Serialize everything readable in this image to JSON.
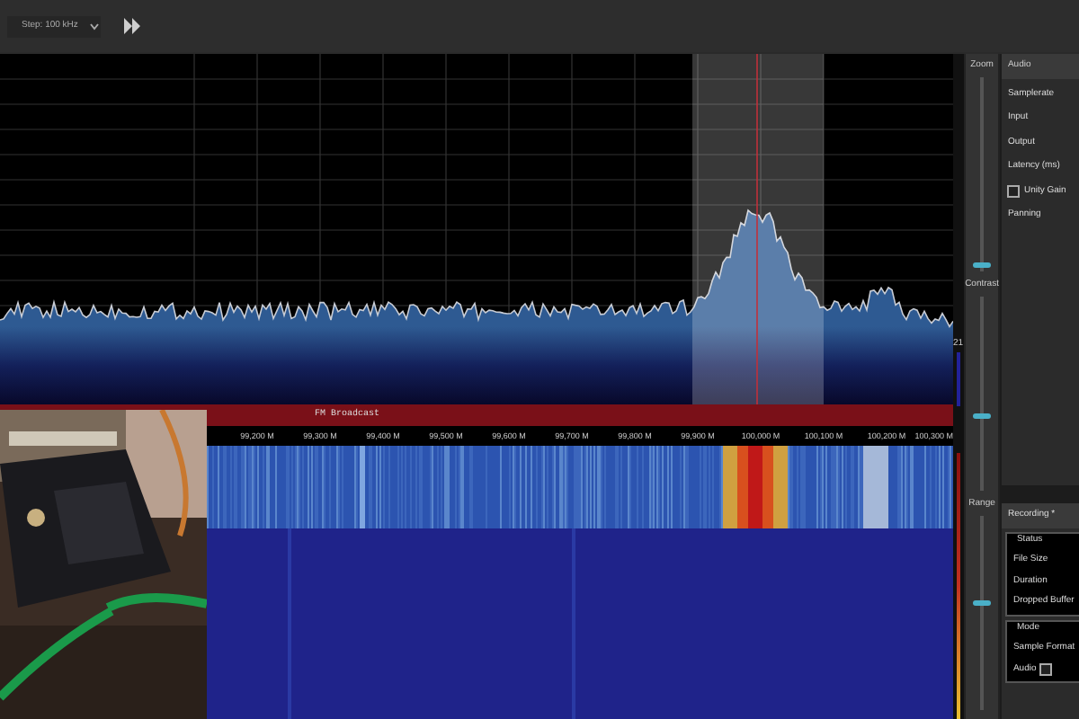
{
  "toolbar": {
    "step": "Step: 100 kHz"
  },
  "band": {
    "label": "FM Broadcast"
  },
  "frequency_axis": [
    "99,200 M",
    "99,300 M",
    "99,400 M",
    "99,500 M",
    "99,600 M",
    "99,700 M",
    "99,800 M",
    "99,900 M",
    "100,000 M",
    "100,100 M",
    "100,200 M",
    "100,300 M"
  ],
  "level_meter": {
    "reading": "21"
  },
  "sliders": [
    {
      "label": "Zoom",
      "level": 0.03
    },
    {
      "label": "Contrast",
      "level": 0.38
    },
    {
      "label": "Range",
      "level": 0.55
    }
  ],
  "audio": {
    "title": "Audio",
    "fields": [
      "Samplerate",
      "Input",
      "Output",
      "Latency (ms)"
    ],
    "unity_gain": {
      "label": "Unity Gain",
      "checked": false
    },
    "panning": "Panning"
  },
  "recording": {
    "title": "Recording *",
    "status": {
      "title": "Status",
      "rows": [
        "File Size",
        "Duration",
        "Dropped Buffer"
      ]
    },
    "mode": {
      "title": "Mode",
      "rows": [
        "Sample Format"
      ],
      "audio": {
        "label": "Audio",
        "checked": false
      }
    }
  }
}
